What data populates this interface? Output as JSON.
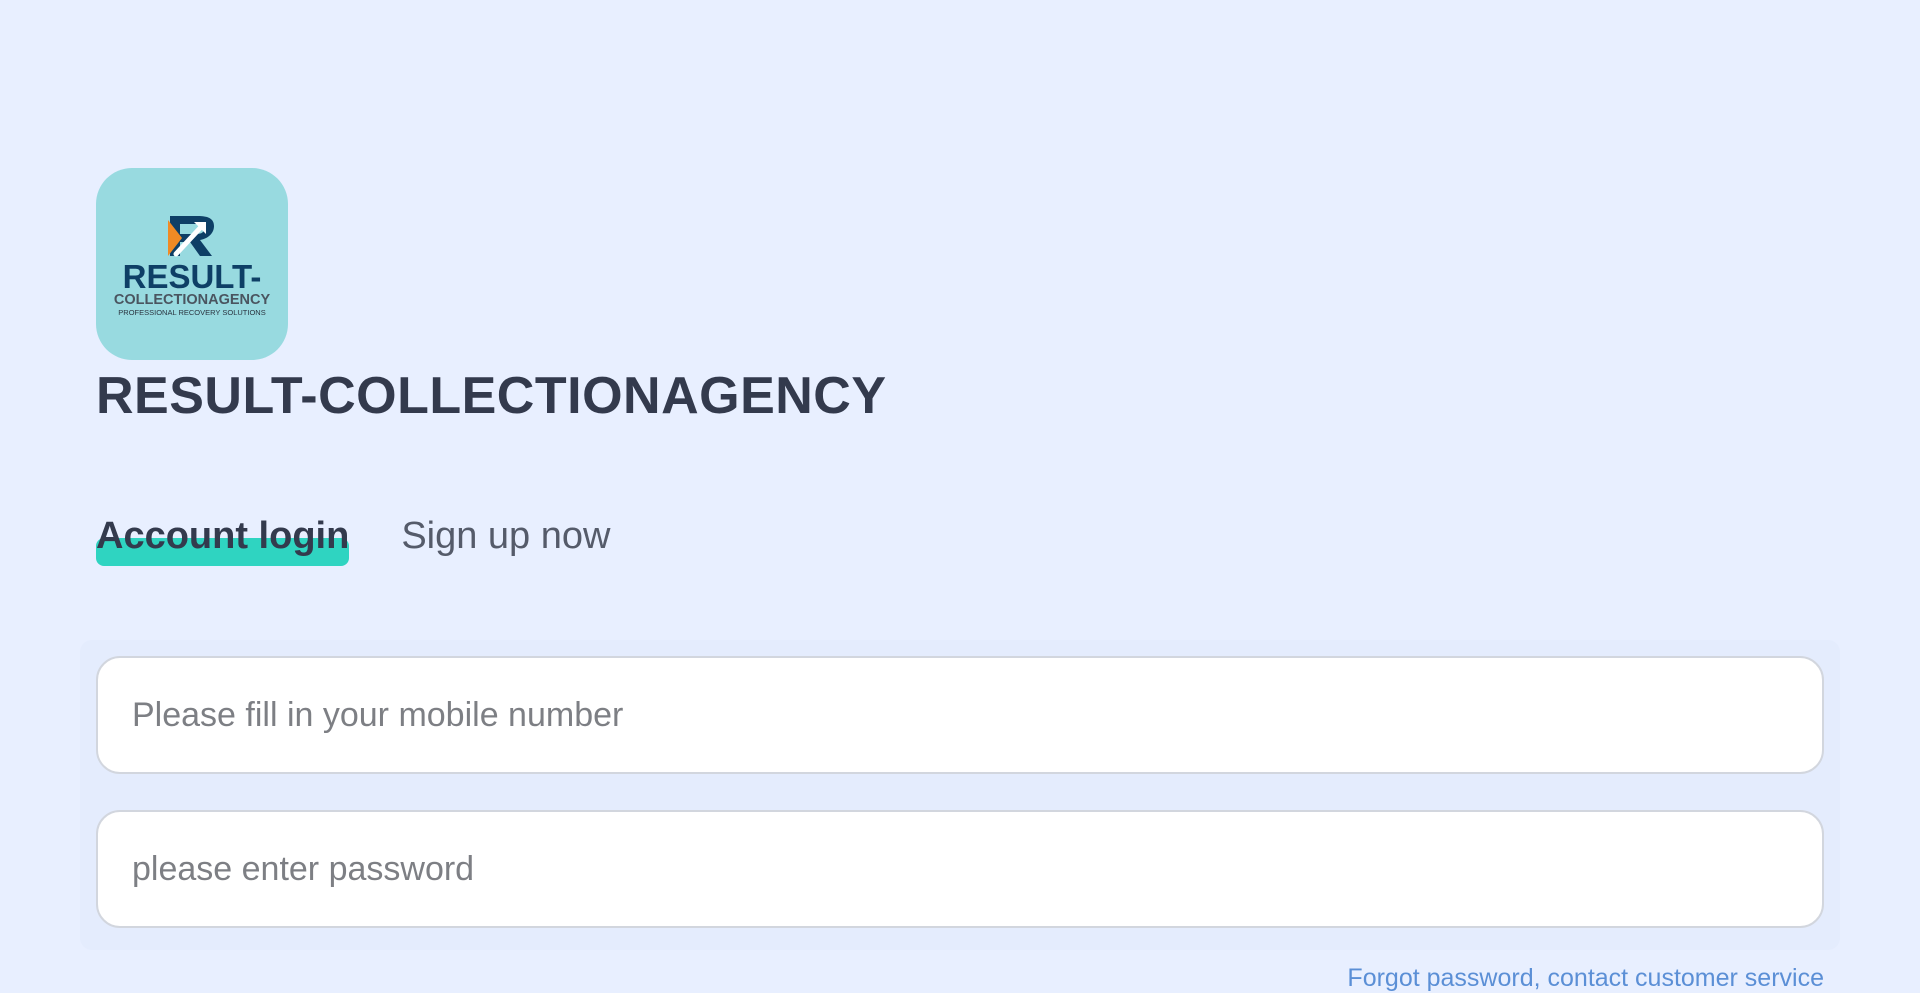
{
  "app": {
    "title": "RESULT-COLLECTIONAGENCY"
  },
  "logo": {
    "icon": "result-collectionagency-logo",
    "background": "#98dae0",
    "wordmark": "RESULT-",
    "subline": "COLLECTIONAGENCY",
    "tagline": "PROFESSIONAL RECOVERY SOLUTIONS",
    "brand_color": "#0e3f66",
    "accent_color": "#f08a24"
  },
  "tabs": [
    {
      "label": "Account login",
      "active": true
    },
    {
      "label": "Sign up now",
      "active": false
    }
  ],
  "form": {
    "mobile": {
      "value": "",
      "placeholder": "Please fill in your mobile number"
    },
    "password": {
      "value": "",
      "placeholder": "please enter password"
    },
    "forgot_label": "Forgot password, contact customer service"
  },
  "colors": {
    "background": "#e8efff",
    "tab_underline": "#2fd4c1",
    "link": "#5b8fd6",
    "title": "#333a4d"
  }
}
